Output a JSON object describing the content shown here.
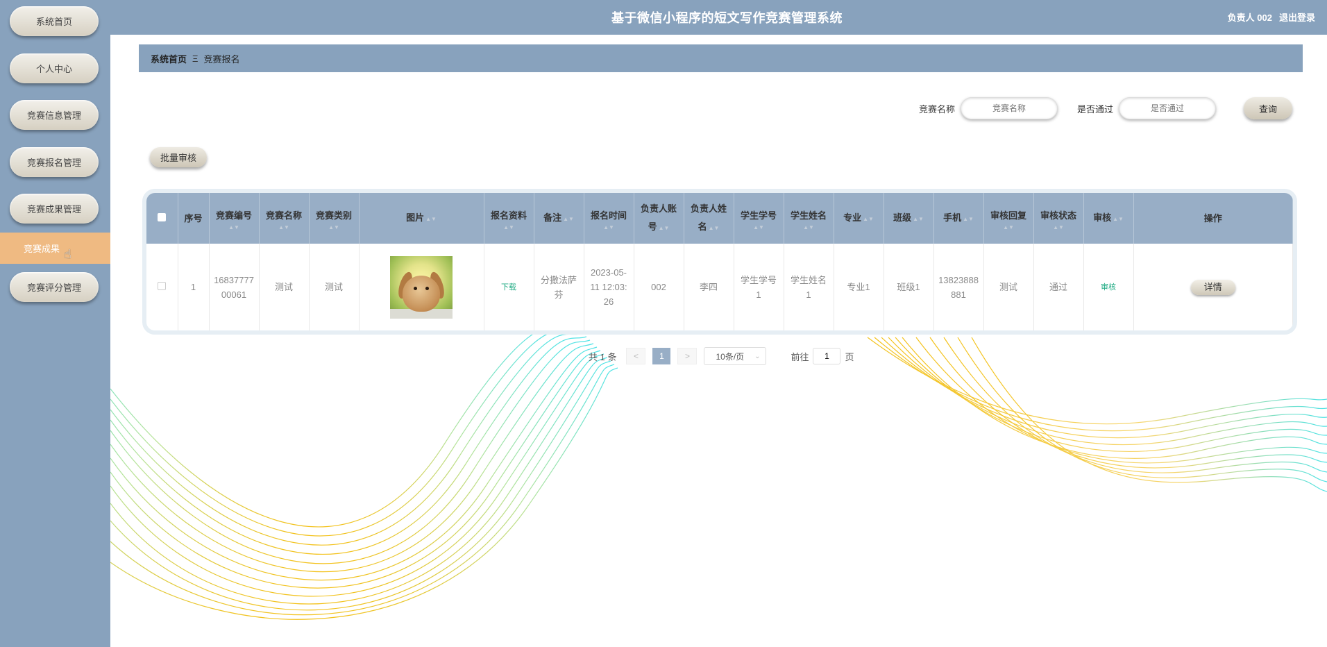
{
  "sidebar": {
    "items": [
      {
        "label": "系统首页"
      },
      {
        "label": "个人中心"
      },
      {
        "label": "竞赛信息管理"
      },
      {
        "label": "竞赛报名管理"
      },
      {
        "label": "竞赛成果管理"
      },
      {
        "label": "竞赛成果"
      },
      {
        "label": "竞赛评分管理"
      }
    ],
    "active_label": "竞赛成果"
  },
  "header": {
    "title": "基于微信小程序的短文写作竞赛管理系统",
    "user": "负责人 002",
    "logout": "退出登录"
  },
  "breadcrumb": {
    "home": "系统首页",
    "separator": "Ξ",
    "current": "竞赛报名"
  },
  "search": {
    "name_label": "竞赛名称",
    "name_placeholder": "竞赛名称",
    "pass_label": "是否通过",
    "pass_placeholder": "是否通过",
    "query_button": "查询"
  },
  "toolbar": {
    "batch_review": "批量审核"
  },
  "table": {
    "headers": {
      "index": "序号",
      "comp_no": "竞赛编号",
      "comp_name": "竞赛名称",
      "comp_type": "竞赛类别",
      "image": "图片",
      "material": "报名资料",
      "remark": "备注",
      "reg_time": "报名时间",
      "owner_account": "负责人账号",
      "owner_name": "负责人姓名",
      "student_no": "学生学号",
      "student_name": "学生姓名",
      "major": "专业",
      "class": "班级",
      "phone": "手机",
      "review_reply": "审核回复",
      "review_status": "审核状态",
      "review": "审核",
      "actions": "操作"
    },
    "rows": [
      {
        "index": "1",
        "comp_no": "1683777700061",
        "comp_name": "测试",
        "comp_type": "测试",
        "image": "rabbit-photo",
        "material": "下载",
        "remark": "分撒法萨芬",
        "reg_time": "2023-05-11 12:03:26",
        "owner_account": "002",
        "owner_name": "李四",
        "student_no": "学生学号1",
        "student_name": "学生姓名1",
        "major": "专业1",
        "class": "班级1",
        "phone": "13823888881",
        "review_reply": "测试",
        "review_status": "通过",
        "review": "审核",
        "action": "详情"
      }
    ]
  },
  "pagination": {
    "total": "共 1 条",
    "prev": "<",
    "current": "1",
    "next": ">",
    "page_size": "10条/页",
    "goto_label": "前往",
    "goto_value": "1",
    "page_suffix": "页"
  },
  "colors": {
    "sidebar_bg": "#88a2bd",
    "active_item": "#efba82",
    "table_header": "#98aec6",
    "link_green": "#1eaa82",
    "wave_cyan": "#4fe3e6",
    "wave_yellow": "#f3c21c"
  }
}
